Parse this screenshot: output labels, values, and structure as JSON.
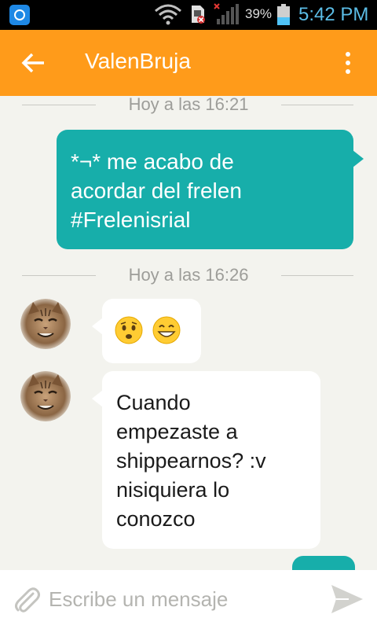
{
  "status_bar": {
    "battery_percent": "39%",
    "time": "5:42 PM",
    "icons": [
      "app-notification-icon",
      "wifi-icon",
      "sim-error-icon",
      "signal-icon",
      "battery-icon"
    ]
  },
  "header": {
    "title": "ValenBruja",
    "back_icon": "arrow-left-icon",
    "menu_icon": "more-vertical-icon",
    "color": "#ff9b1a"
  },
  "messages": {
    "sep1": "Hoy a las 16:21",
    "sep2": "Hoy a las 16:26",
    "out1": {
      "line1": "*¬* me acabo de",
      "line2": "acordar del frelen",
      "line3": "#Frelenisrial"
    },
    "in1": {
      "emojis": [
        "anxious-face-emoji",
        "grinning-face-emoji"
      ]
    },
    "in2": {
      "line1": "Cuando",
      "line2": "empezaste a",
      "line3": "shippearnos? :v",
      "line4": "nisiquiera lo",
      "line5": "conozco"
    },
    "outgoing_color": "#17aeaa",
    "incoming_color": "#ffffff"
  },
  "composer": {
    "placeholder": "Escribe un mensaje",
    "value": "",
    "attach_icon": "paperclip-icon",
    "send_icon": "send-icon"
  }
}
